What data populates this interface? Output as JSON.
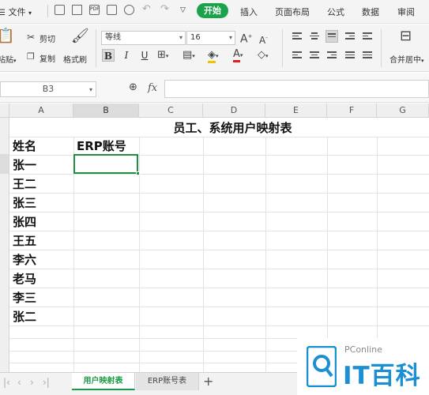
{
  "menubar": {
    "items": [
      "文件",
      "开始",
      "插入",
      "页面布局",
      "公式",
      "数据",
      "审阅"
    ]
  },
  "ribbon": {
    "paste_label": "粘贴",
    "cut_label": "剪切",
    "copy_label": "复制",
    "format_painter_label": "格式刷",
    "font_name": "等线",
    "font_size": "16",
    "bold": "B",
    "italic": "I",
    "underline": "U",
    "merge_label": "合并居中"
  },
  "formula_bar": {
    "name_box": "B3",
    "fx": "fx",
    "value": ""
  },
  "sheet": {
    "columns": [
      "A",
      "B",
      "C",
      "D",
      "E",
      "F",
      "G"
    ],
    "active_column": "B",
    "title": "员工、系统用户映射表",
    "headers": [
      "姓名",
      "ERP账号"
    ],
    "names": [
      "张一",
      "王二",
      "张三",
      "张四",
      "王五",
      "李六",
      "老马",
      "李三",
      "张二"
    ],
    "selected_cell": "B3"
  },
  "tabs": {
    "items": [
      "用户映射表",
      "ERP账号表"
    ],
    "active": "用户映射表",
    "add": "+"
  },
  "watermark": {
    "small": "PConline",
    "big": "IT百科"
  },
  "colors": {
    "accent": "#1aa34a",
    "selection": "#1f8e3f",
    "watermark": "#1b8fd4"
  }
}
